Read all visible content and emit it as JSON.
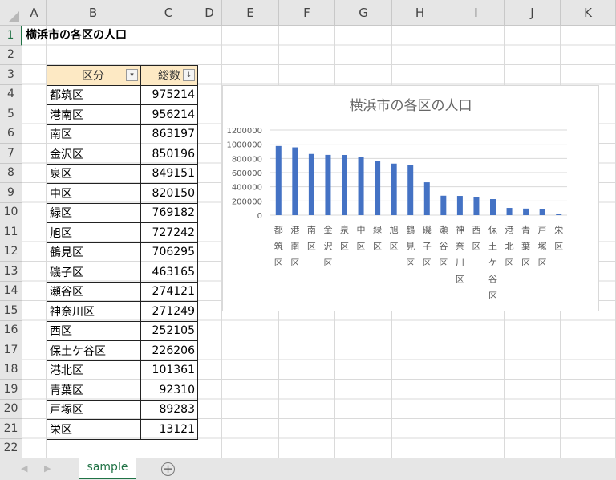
{
  "columns": [
    "A",
    "B",
    "C",
    "D",
    "E",
    "F",
    "G",
    "H",
    "I",
    "J",
    "K"
  ],
  "rows": [
    "1",
    "2",
    "3",
    "4",
    "5",
    "6",
    "7",
    "8",
    "9",
    "10",
    "11",
    "12",
    "13",
    "14",
    "15",
    "16",
    "17",
    "18",
    "19",
    "20",
    "21",
    "22"
  ],
  "sheet_title": "横浜市の各区の人口",
  "table": {
    "headers": [
      "区分",
      "総数"
    ],
    "filter_icons": [
      "▾",
      "↓"
    ],
    "rows": [
      [
        "都筑区",
        "975214"
      ],
      [
        "港南区",
        "956214"
      ],
      [
        "南区",
        "863197"
      ],
      [
        "金沢区",
        "850196"
      ],
      [
        "泉区",
        "849151"
      ],
      [
        "中区",
        "820150"
      ],
      [
        "緑区",
        "769182"
      ],
      [
        "旭区",
        "727242"
      ],
      [
        "鶴見区",
        "706295"
      ],
      [
        "磯子区",
        "463165"
      ],
      [
        "瀬谷区",
        "274121"
      ],
      [
        "神奈川区",
        "271249"
      ],
      [
        "西区",
        "252105"
      ],
      [
        "保土ケ谷区",
        "226206"
      ],
      [
        "港北区",
        "101361"
      ],
      [
        "青葉区",
        "92310"
      ],
      [
        "戸塚区",
        "89283"
      ],
      [
        "栄区",
        "13121"
      ]
    ]
  },
  "chart_data": {
    "type": "bar",
    "title": "横浜市の各区の人口",
    "categories": [
      "都筑区",
      "港南区",
      "南区",
      "金沢区",
      "泉区",
      "中区",
      "緑区",
      "旭区",
      "鶴見区",
      "磯子区",
      "瀬谷区",
      "神奈川区",
      "西区",
      "保土ケ谷区",
      "港北区",
      "青葉区",
      "戸塚区",
      "栄区"
    ],
    "values": [
      975214,
      956214,
      863197,
      850196,
      849151,
      820150,
      769182,
      727242,
      706295,
      463165,
      274121,
      271249,
      252105,
      226206,
      101361,
      92310,
      89283,
      13121
    ],
    "yticks": [
      "0",
      "200000",
      "400000",
      "600000",
      "800000",
      "1000000",
      "1200000"
    ],
    "ylim": [
      0,
      1200000
    ],
    "bar_color": "#4472c4",
    "grid": true
  },
  "tabs": {
    "sheet": "sample",
    "add": "+",
    "prev": "◀",
    "next": "▶"
  }
}
